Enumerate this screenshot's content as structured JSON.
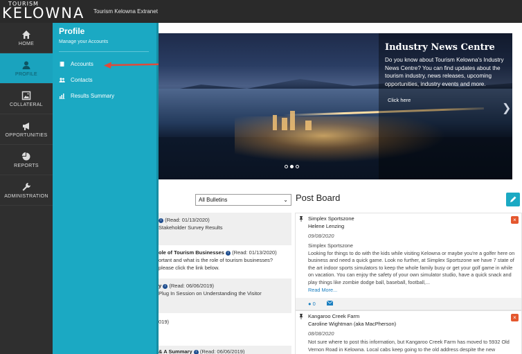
{
  "topbar": {
    "logo_small": "TOURISM",
    "logo_big": "KELOWNA",
    "app_title": "Tourism Kelowna Extranet"
  },
  "leftnav": {
    "items": [
      {
        "label": "HOME",
        "icon": "home-icon"
      },
      {
        "label": "PROFILE",
        "icon": "user-icon",
        "active": true
      },
      {
        "label": "COLLATERAL",
        "icon": "image-icon"
      },
      {
        "label": "OPPORTUNITIES",
        "icon": "megaphone-icon"
      },
      {
        "label": "REPORTS",
        "icon": "pie-chart-icon"
      },
      {
        "label": "ADMINISTRATION",
        "icon": "wrench-icon"
      }
    ]
  },
  "flyout": {
    "title": "Profile",
    "subtitle": "Manage your Accounts",
    "items": [
      {
        "label": "Accounts",
        "icon": "book-icon"
      },
      {
        "label": "Contacts",
        "icon": "users-icon"
      },
      {
        "label": "Results Summary",
        "icon": "bar-chart-icon"
      }
    ]
  },
  "hero": {
    "title": "Industry News Centre",
    "body": "Do you know about Tourism Kelowna's Industry News Centre? You can find updates about the tourism industry, news releases, upcoming opportunities, industry events and more.",
    "link": "Click here"
  },
  "bulletins": {
    "select_value": "All Bulletins",
    "items": [
      {
        "title": "",
        "read": "(Read: 01/13/2020)",
        "desc": "Stakeholder Survey Results"
      },
      {
        "title": "ole of Tourism Businesses",
        "read": "(Read: 01/13/2020)",
        "desc1": "ortant and what is the role of tourism businesses?",
        "desc2": "please click the link below."
      },
      {
        "title": "y",
        "read": "(Read: 06/06/2019)",
        "desc1": "Plug In Session on Understanding the Visitor"
      },
      {
        "title": "",
        "read": "",
        "desc1": "019)"
      },
      {
        "title": "& A Summary",
        "read": "(Read: 06/06/2019)"
      }
    ]
  },
  "postboard": {
    "title": "Post Board",
    "posts": [
      {
        "org": "Simplex Sportszone",
        "name": "Helene Lenzing",
        "date": "09/08/2020",
        "body_title": "Simplex Sportszone",
        "body": "Looking for things to do with the kids while visiting Kelowna or maybe you're a golfer here on business and need a quick game. Look no further, at Simplex Sportszone we have 7 state of the art indoor sports simulators to keep the whole family busy or get your golf game in while on vacation. You can enjoy the safety of your own simulator studio, have a quick snack and play things like zombie dodge ball, baseball, football,...",
        "more": "Read More...",
        "comments": "0"
      },
      {
        "org": "Kangaroo Creek Farm",
        "name": "Caroline Wightman (aka MacPherson)",
        "date": "08/08/2020",
        "body": "Not sure where to post this information, but Kangaroo Creek Farm has moved to 5932 Old Vernon Road in Kelowna. Local cabs keep going to the old address despite the new"
      }
    ]
  }
}
